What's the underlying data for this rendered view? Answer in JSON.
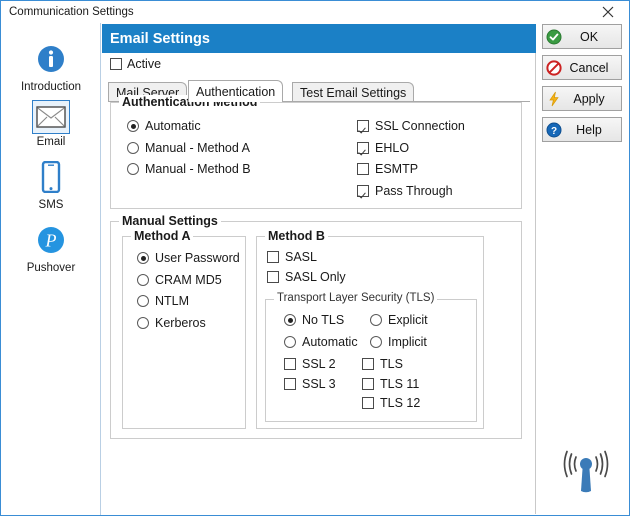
{
  "window": {
    "title": "Communication Settings",
    "close_icon": "close-icon",
    "accent_color": "#1b80c6",
    "border_color": "#3a8dd5"
  },
  "sidebar": {
    "items": [
      {
        "label": "Introduction",
        "icon": "info-icon",
        "selected": false
      },
      {
        "label": "Email",
        "icon": "envelope-icon",
        "selected": true
      },
      {
        "label": "SMS",
        "icon": "mobile-phone-icon",
        "selected": false
      },
      {
        "label": "Pushover",
        "icon": "pushover-icon",
        "selected": false
      }
    ]
  },
  "panel": {
    "header_title": "Email Settings",
    "active_checkbox": {
      "label": "Active",
      "checked": false
    }
  },
  "tabs": [
    {
      "label": "Mail Server",
      "selected": false
    },
    {
      "label": "Authentication",
      "selected": true
    },
    {
      "label": "Test Email Settings",
      "selected": false
    }
  ],
  "auth_method": {
    "group_title": "Authentication Method",
    "radios": [
      {
        "label": "Automatic",
        "checked": true
      },
      {
        "label": "Manual - Method A",
        "checked": false
      },
      {
        "label": "Manual - Method B",
        "checked": false
      }
    ],
    "checkboxes": [
      {
        "label": "SSL Connection",
        "checked": true
      },
      {
        "label": "EHLO",
        "checked": true
      },
      {
        "label": "ESMTP",
        "checked": false
      },
      {
        "label": "Pass Through",
        "checked": true
      }
    ]
  },
  "manual_settings": {
    "group_title": "Manual Settings",
    "method_a": {
      "group_title": "Method A",
      "radios": [
        {
          "label": "User Password",
          "checked": true
        },
        {
          "label": "CRAM MD5",
          "checked": false
        },
        {
          "label": "NTLM",
          "checked": false
        },
        {
          "label": "Kerberos",
          "checked": false
        }
      ]
    },
    "method_b": {
      "group_title": "Method B",
      "checkboxes": [
        {
          "label": "SASL",
          "checked": false
        },
        {
          "label": "SASL Only",
          "checked": false
        }
      ],
      "tls": {
        "group_title": "Transport Layer Security (TLS)",
        "radios_left": [
          {
            "label": "No TLS",
            "checked": true
          },
          {
            "label": "Automatic",
            "checked": false
          }
        ],
        "radios_right": [
          {
            "label": "Explicit",
            "checked": false
          },
          {
            "label": "Implicit",
            "checked": false
          }
        ],
        "checkboxes_left": [
          {
            "label": "SSL 2",
            "checked": false
          },
          {
            "label": "SSL 3",
            "checked": false
          }
        ],
        "checkboxes_right": [
          {
            "label": "TLS",
            "checked": false
          },
          {
            "label": "TLS 11",
            "checked": false
          },
          {
            "label": "TLS 12",
            "checked": false
          }
        ]
      }
    }
  },
  "buttons": [
    {
      "label": "OK",
      "icon": "check-circle-icon",
      "color": "#3a9b42"
    },
    {
      "label": "Cancel",
      "icon": "no-entry-icon",
      "color": "#cc2222"
    },
    {
      "label": "Apply",
      "icon": "lightning-bolt-icon",
      "color": "#f5b218"
    },
    {
      "label": "Help",
      "icon": "question-circle-icon",
      "color": "#1668b8"
    }
  ],
  "status_icon": {
    "name": "antenna-broadcast-icon",
    "color": "#3b7bb8"
  }
}
